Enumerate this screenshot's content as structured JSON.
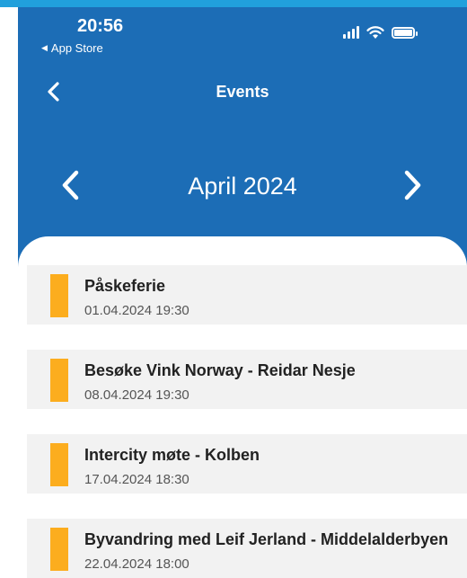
{
  "status_bar": {
    "time": "20:56",
    "back_app": "App Store"
  },
  "nav": {
    "title": "Events"
  },
  "month": {
    "label": "April 2024"
  },
  "colors": {
    "header_bg": "#1c6db6",
    "accent_bar": "#fcad1e",
    "card_bg": "#f2f2f2"
  },
  "events": [
    {
      "title": "Påskeferie",
      "date": "01.04.2024 19:30"
    },
    {
      "title": "Besøke Vink Norway - Reidar Nesje",
      "date": "08.04.2024 19:30"
    },
    {
      "title": "Intercity møte - Kolben",
      "date": "17.04.2024 18:30"
    },
    {
      "title": "Byvandring  med Leif Jerland - Middelalderbyen",
      "date": "22.04.2024 18:00"
    }
  ]
}
